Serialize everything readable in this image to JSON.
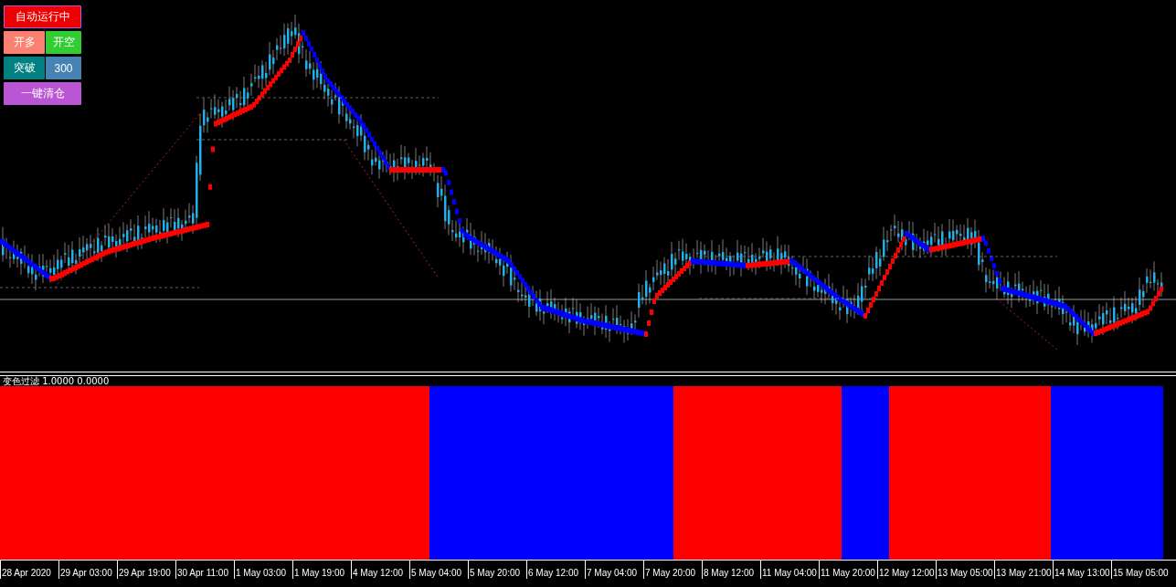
{
  "buttons": [
    {
      "label": "自动运行中",
      "kind": "status"
    },
    {
      "label": "开多",
      "kind": "buy"
    },
    {
      "label": "开空",
      "kind": "sell"
    },
    {
      "label": "突破",
      "kind": "breakout"
    },
    {
      "label": "一键清仓",
      "kind": "close-all"
    }
  ],
  "breakout_input": {
    "value": "300"
  },
  "indicator": {
    "label": "变色过滤 1.0000 0.0000"
  },
  "time_axis": [
    "28 Apr 2020",
    "29 Apr 03:00",
    "29 Apr 19:00",
    "30 Apr 11:00",
    "1 May 03:00",
    "1 May 19:00",
    "4 May 12:00",
    "5 May 04:00",
    "5 May 20:00",
    "6 May 12:00",
    "7 May 04:00",
    "7 May 20:00",
    "8 May 12:00",
    "11 May 04:00",
    "11 May 20:00",
    "12 May 12:00",
    "13 May 05:00",
    "13 May 21:00",
    "14 May 13:00",
    "15 May 05:00"
  ]
}
